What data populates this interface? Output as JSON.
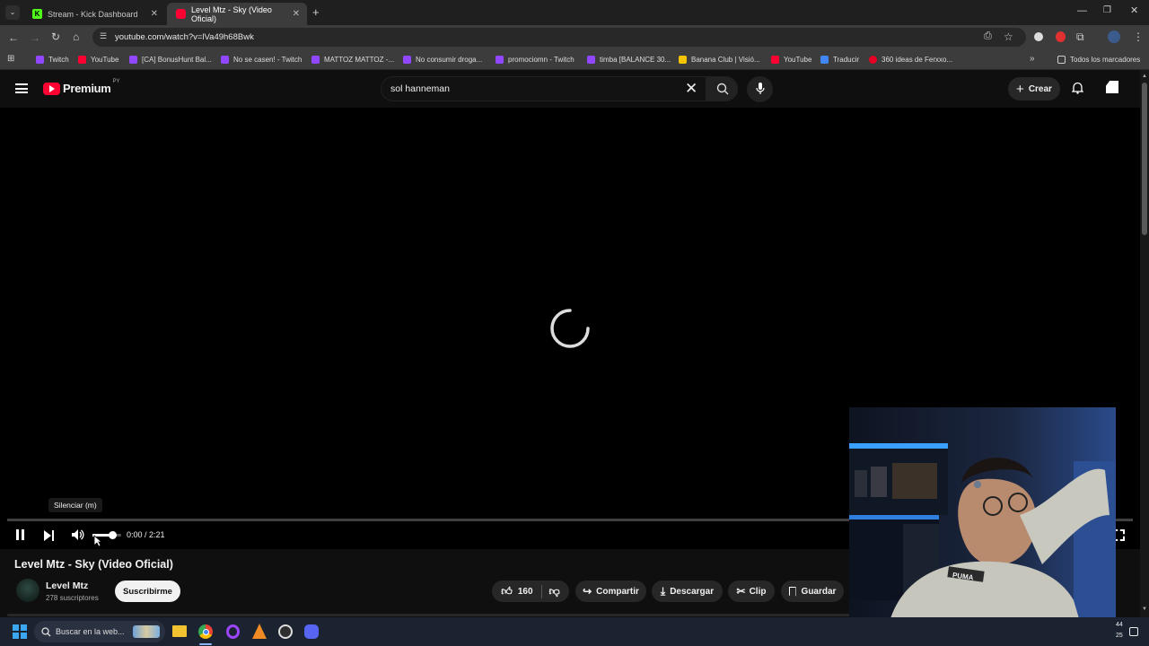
{
  "browser": {
    "tabs": [
      {
        "label": "Stream - Kick Dashboard",
        "color": "#53fc18"
      },
      {
        "label": "Level Mtz - Sky (Video Oficial)",
        "color": "#ff0033"
      }
    ],
    "url": "youtube.com/watch?v=lVa49h68Bwk",
    "bookmarks": [
      {
        "label": "Twitch",
        "color": "#9146ff"
      },
      {
        "label": "YouTube",
        "color": "#ff0033"
      },
      {
        "label": "[CA] BonusHunt Bal...",
        "color": "#9146ff"
      },
      {
        "label": "No se casen! - Twitch",
        "color": "#9146ff"
      },
      {
        "label": "MATTOZ MATTOZ -...",
        "color": "#9146ff"
      },
      {
        "label": "No consumir droga...",
        "color": "#9146ff"
      },
      {
        "label": "promociomn - Twitch",
        "color": "#9146ff"
      },
      {
        "label": "timba [BALANCE 30...",
        "color": "#9146ff"
      },
      {
        "label": "Banana Club | Visió...",
        "color": "#f5c400"
      },
      {
        "label": "YouTube",
        "color": "#ff0033"
      },
      {
        "label": "Traducir",
        "color": "#4285f4"
      },
      {
        "label": "360 ideas de Ferxxo...",
        "color": "#e60023"
      }
    ],
    "all_bookmarks": "Todos los marcadores"
  },
  "youtube": {
    "logo": "Premium",
    "region": "PY",
    "search_value": "sol hanneman",
    "create_label": "Crear",
    "tooltip": "Silenciar (m)",
    "time": "0:00 / 2:21",
    "volume_fraction": 0.7,
    "video_title": "Level Mtz - Sky (Video Oficial)",
    "channel_name": "Level Mtz",
    "subscribers": "278 suscriptores",
    "subscribe_label": "Suscribirme",
    "likes": "160",
    "share_label": "Compartir",
    "download_label": "Descargar",
    "clip_label": "Clip",
    "save_label": "Guardar"
  },
  "taskbar": {
    "search_placeholder": "Buscar en la web...",
    "clock_top": "44",
    "clock_bottom": "25"
  },
  "webcam": {
    "shirt_text": "PUMA"
  }
}
